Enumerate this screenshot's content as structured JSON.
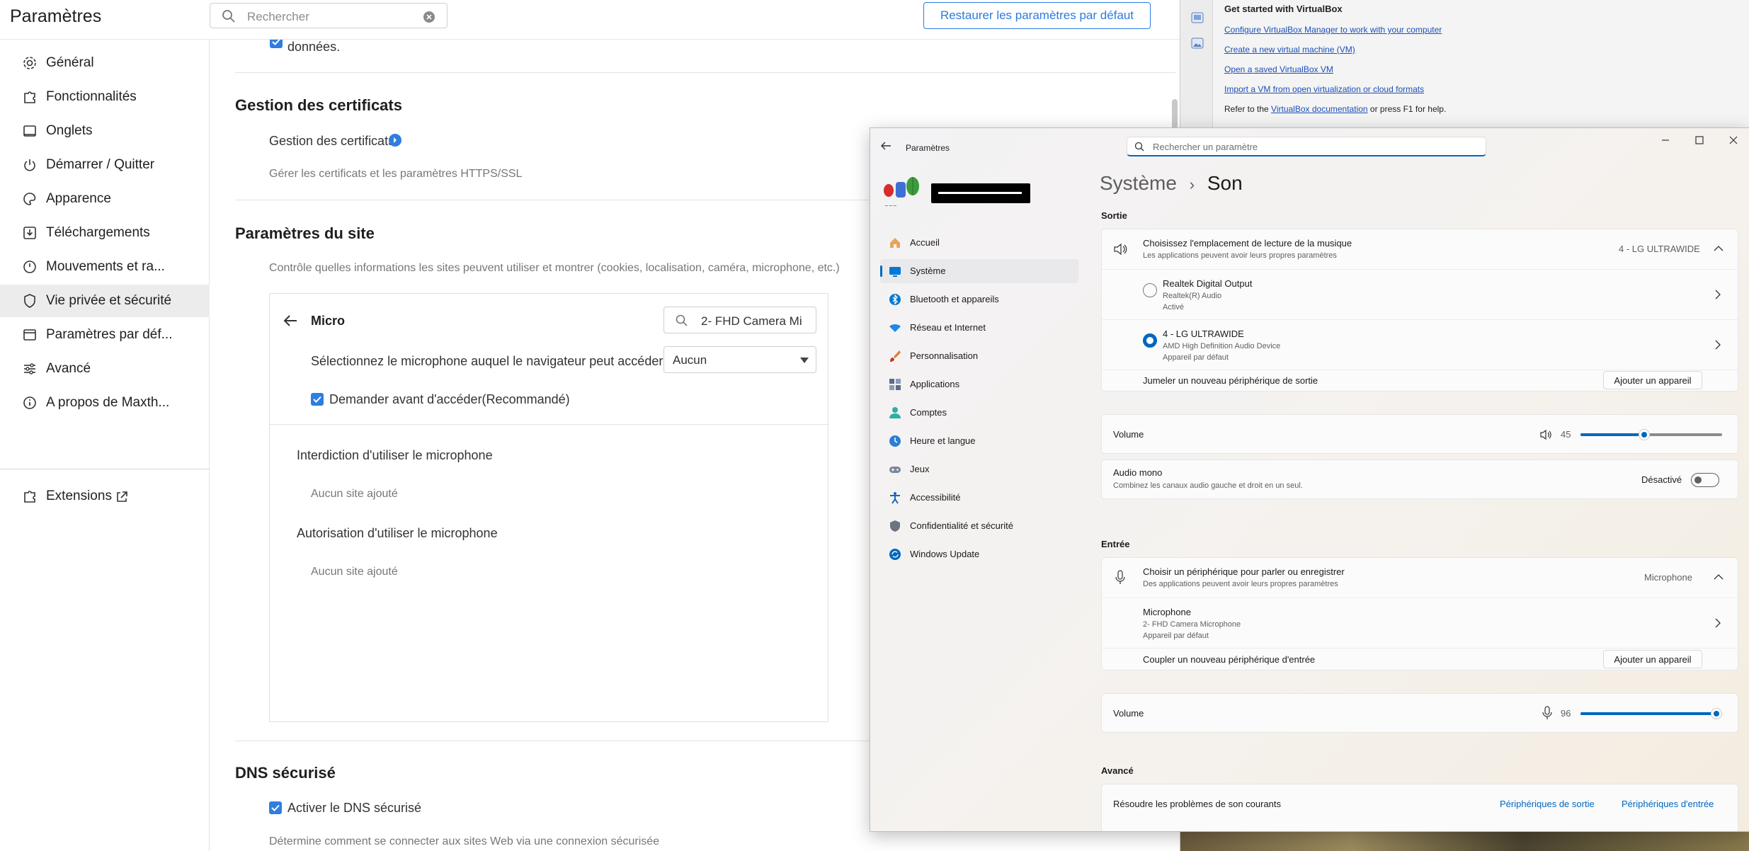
{
  "browser": {
    "title": "Paramètres",
    "search_placeholder": "Rechercher",
    "restore_button": "Restaurer les paramètres par défaut",
    "sidebar": [
      {
        "label": "Général",
        "icon": "gear-icon"
      },
      {
        "label": "Fonctionnalités",
        "icon": "puzzle-icon"
      },
      {
        "label": "Onglets",
        "icon": "tab-icon"
      },
      {
        "label": "Démarrer / Quitter",
        "icon": "power-icon"
      },
      {
        "label": "Apparence",
        "icon": "palette-icon"
      },
      {
        "label": "Téléchargements",
        "icon": "download-icon"
      },
      {
        "label": "Mouvements et ra...",
        "icon": "mouse-icon"
      },
      {
        "label": "Vie privée et sécurité",
        "icon": "shield-icon"
      },
      {
        "label": "Paramètres par déf...",
        "icon": "browser-icon"
      },
      {
        "label": "Avancé",
        "icon": "sliders-icon"
      },
      {
        "label": "A propos de Maxth...",
        "icon": "info-icon"
      }
    ],
    "extensions_label": "Extensions",
    "main": {
      "top_item": "données.",
      "certs_heading": "Gestion des certificats",
      "certs_link": "Gestion des certificats",
      "certs_desc": "Gérer les certificats et les paramètres HTTPS/SSL",
      "site_heading": "Paramètres du site",
      "site_desc": "Contrôle quelles informations les sites peuvent utiliser et montrer (cookies, localisation, caméra, microphone, etc.)",
      "micro_title": "Micro",
      "micro_search_value": "2- FHD Camera Mi",
      "select_mic_label": "Sélectionnez le microphone auquel le navigateur peut accéder",
      "select_mic_value": "Aucun",
      "ask_before": "Demander avant d'accéder(Recommandé)",
      "block_heading": "Interdiction d'utiliser le microphone",
      "block_empty": "Aucun site ajouté",
      "allow_heading": "Autorisation d'utiliser le microphone",
      "allow_empty": "Aucun site ajouté",
      "dns_heading": "DNS sécurisé",
      "dns_enable": "Activer le DNS sécurisé",
      "dns_desc": "Détermine comment se connecter aux sites Web via une connexion sécurisée"
    }
  },
  "virtualbox": {
    "heading": "Get started with VirtualBox",
    "links": [
      "Configure VirtualBox Manager to work with your computer",
      "Create a new virtual machine (VM)",
      "Open a saved VirtualBox VM",
      "Import a VM from open virtualization or cloud formats"
    ],
    "refer_prefix": "Refer to the ",
    "refer_link": "VirtualBox documentation",
    "refer_suffix": " or press F1 for help."
  },
  "win_settings": {
    "window_title": "Paramètres",
    "search_placeholder": "Rechercher un paramètre",
    "breadcrumb_parent": "Système",
    "breadcrumb_sep": "›",
    "page_title": "Son",
    "nav": [
      {
        "label": "Accueil",
        "icon": "home-icon",
        "color": "#d9863a"
      },
      {
        "label": "Système",
        "icon": "monitor-icon",
        "color": "#0078d4"
      },
      {
        "label": "Bluetooth et appareils",
        "icon": "bluetooth-icon",
        "color": "#0078d4"
      },
      {
        "label": "Réseau et Internet",
        "icon": "wifi-icon",
        "color": "#1e88e5"
      },
      {
        "label": "Personnalisation",
        "icon": "brush-icon",
        "color": "#e07b30"
      },
      {
        "label": "Applications",
        "icon": "apps-icon",
        "color": "#5a6a8a"
      },
      {
        "label": "Comptes",
        "icon": "person-icon",
        "color": "#2bb0a2"
      },
      {
        "label": "Heure et langue",
        "icon": "globe-clock-icon",
        "color": "#2a7fd4"
      },
      {
        "label": "Jeux",
        "icon": "gamepad-icon",
        "color": "#7a8699"
      },
      {
        "label": "Accessibilité",
        "icon": "accessibility-icon",
        "color": "#1565c0"
      },
      {
        "label": "Confidentialité et sécurité",
        "icon": "shield-icon",
        "color": "#6b7480"
      },
      {
        "label": "Windows Update",
        "icon": "update-icon",
        "color": "#0067c0"
      }
    ],
    "output_section": "Sortie",
    "output_header_title": "Choisissez l'emplacement de lecture de la musique",
    "output_header_sub": "Les applications peuvent avoir leurs propres paramètres",
    "output_selected": "4 - LG ULTRAWIDE",
    "output_devices": [
      {
        "name": "Realtek Digital Output",
        "driver": "Realtek(R) Audio",
        "status": "Activé",
        "selected": false
      },
      {
        "name": "4 - LG ULTRAWIDE",
        "driver": "AMD High Definition Audio Device",
        "status": "Appareil par défaut",
        "selected": true
      }
    ],
    "pair_output": "Jumeler un nouveau périphérique de sortie",
    "add_device": "Ajouter un appareil",
    "volume_label": "Volume",
    "output_volume": "45",
    "output_volume_level": 0.45,
    "mono_title": "Audio mono",
    "mono_sub": "Combinez les canaux audio gauche et droit en un seul.",
    "mono_state": "Désactivé",
    "input_section": "Entrée",
    "input_header_title": "Choisir un périphérique pour parler ou enregistrer",
    "input_header_sub": "Des applications peuvent avoir leurs propres paramètres",
    "input_selected": "Microphone",
    "input_device": {
      "name": "Microphone",
      "driver": "2- FHD Camera Microphone",
      "status": "Appareil par défaut"
    },
    "pair_input": "Coupler un nouveau périphérique d'entrée",
    "input_volume": "96",
    "input_volume_level": 0.96,
    "advanced_section": "Avancé",
    "troubleshoot": "Résoudre les problèmes de son courants",
    "link_output": "Périphériques de sortie",
    "link_input": "Périphériques d'entrée"
  }
}
